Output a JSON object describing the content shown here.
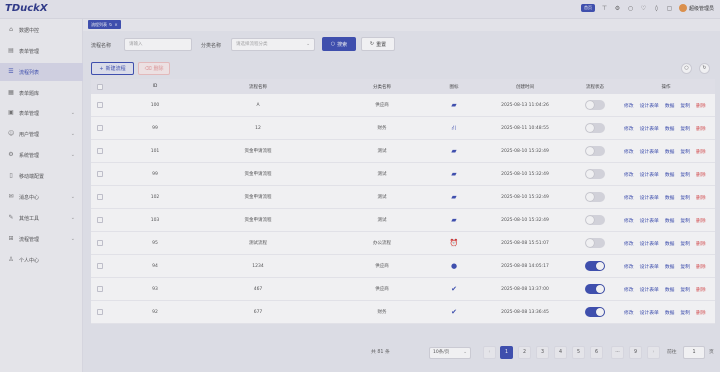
{
  "app": {
    "logo": "TDuckX"
  },
  "topbar": {
    "home_label": "首页",
    "user_name": "超级管理员"
  },
  "sidebar": {
    "items": [
      {
        "label": "数据中控",
        "icon": "home-icon",
        "chevron": false
      },
      {
        "label": "表单管理",
        "icon": "form-icon",
        "chevron": false
      },
      {
        "label": "流程列表",
        "icon": "flow-icon",
        "chevron": false,
        "active": true
      },
      {
        "label": "表单题库",
        "icon": "library-icon",
        "chevron": false
      },
      {
        "label": "表单管理",
        "icon": "folder-icon",
        "chevron": true
      },
      {
        "label": "用户管理",
        "icon": "user-icon",
        "chevron": true
      },
      {
        "label": "系统管理",
        "icon": "gear-icon",
        "chevron": true
      },
      {
        "label": "移动端配置",
        "icon": "mobile-icon",
        "chevron": false
      },
      {
        "label": "消息中心",
        "icon": "message-icon",
        "chevron": true
      },
      {
        "label": "其他工具",
        "icon": "tool-icon",
        "chevron": true
      },
      {
        "label": "流程管理",
        "icon": "flow-manage-icon",
        "chevron": true
      },
      {
        "label": "个人中心",
        "icon": "person-icon",
        "chevron": false
      }
    ]
  },
  "tabs": [
    {
      "label": "流程列表"
    }
  ],
  "filters": {
    "name_label": "流程名称",
    "name_placeholder": "请输入",
    "category_label": "分类名称",
    "category_placeholder": "请选择流程分类",
    "search_label": "搜索",
    "reset_label": "重置"
  },
  "actions": {
    "new_label": "新建流程",
    "delete_label": "删除"
  },
  "table": {
    "headers": {
      "id": "ID",
      "name": "流程名称",
      "category": "分类名称",
      "icon": "图标",
      "created": "创建时间",
      "status": "流程状态",
      "ops": "操作"
    },
    "op_labels": [
      "修改",
      "设计表单",
      "数据",
      "复制",
      "删除"
    ],
    "rows": [
      {
        "id": "100",
        "name": "A",
        "category": "供应商",
        "icon": "briefcase-icon",
        "icon_glyph": "▰",
        "created": "2025-08-13 11:04:26",
        "status": false
      },
      {
        "id": "99",
        "name": "12",
        "category": "财务",
        "icon": "network-icon",
        "icon_glyph": "⛙",
        "created": "2025-08-11 10:48:55",
        "status": false
      },
      {
        "id": "101",
        "name": "资金申请流程",
        "category": "测试",
        "icon": "bag-icon",
        "icon_glyph": "▰",
        "created": "2025-08-10 15:32:49",
        "status": false
      },
      {
        "id": "99",
        "name": "资金申请流程",
        "category": "测试",
        "icon": "bag-icon",
        "icon_glyph": "▰",
        "created": "2025-08-10 15:32:49",
        "status": false
      },
      {
        "id": "102",
        "name": "资金申请流程",
        "category": "测试",
        "icon": "bag-icon",
        "icon_glyph": "▰",
        "created": "2025-08-10 15:32:49",
        "status": false
      },
      {
        "id": "103",
        "name": "资金申请流程",
        "category": "测试",
        "icon": "bag-icon",
        "icon_glyph": "▰",
        "created": "2025-08-10 15:32:49",
        "status": false
      },
      {
        "id": "95",
        "name": "测试流程",
        "category": "办公流程",
        "icon": "alarm-icon",
        "icon_glyph": "⏰",
        "created": "2025-08-08 15:51:07",
        "status": false
      },
      {
        "id": "94",
        "name": "1234",
        "category": "供应商",
        "icon": "clock-circle-icon",
        "icon_glyph": "●",
        "created": "2025-08-08 14:05:17",
        "status": true
      },
      {
        "id": "93",
        "name": "467",
        "category": "供应商",
        "icon": "check-circle-icon",
        "icon_glyph": "✔",
        "created": "2025-08-08 13:37:00",
        "status": true
      },
      {
        "id": "92",
        "name": "677",
        "category": "财务",
        "icon": "check-circle-icon",
        "icon_glyph": "✔",
        "created": "2025-08-08 13:36:45",
        "status": true
      }
    ]
  },
  "pagination": {
    "total_text": "共 81 条",
    "page_size": "10条/页",
    "pages": [
      "1",
      "2",
      "3",
      "4",
      "5",
      "6",
      "···",
      "9"
    ],
    "current": "1",
    "goto_label": "前往",
    "goto_value": "1",
    "page_suffix": "页"
  },
  "colors": {
    "accent": "#3f51b5",
    "danger": "#e05252"
  }
}
